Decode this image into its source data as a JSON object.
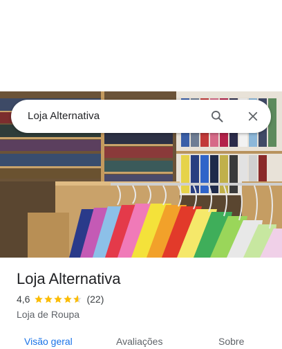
{
  "search": {
    "query": "Loja Alternativa",
    "search_icon": "search-icon",
    "close_icon": "close-icon"
  },
  "place": {
    "name": "Loja Alternativa",
    "rating": "4,6",
    "rating_value": 4.6,
    "reviews": "(22)",
    "category": "Loja de Roupa"
  },
  "tabs": [
    {
      "label": "Visão geral",
      "active": true
    },
    {
      "label": "Avaliações",
      "active": false
    },
    {
      "label": "Sobre",
      "active": false
    }
  ],
  "colors": {
    "accent": "#1a73e8",
    "star": "#fbbc04"
  }
}
